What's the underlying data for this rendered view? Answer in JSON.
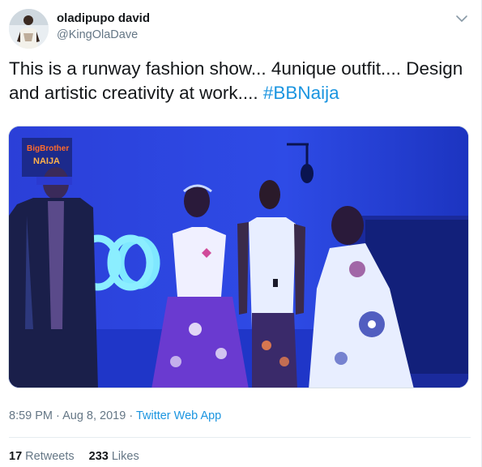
{
  "author": {
    "display_name": "oladipupo david",
    "handle": "@KingOlaDave",
    "avatar_icon": "profile-photo"
  },
  "menu": {
    "icon": "chevron-down-icon"
  },
  "tweet": {
    "text": "This is a runway fashion show... 4unique outfit.... Design and artistic creativity at work....",
    "hashtag": "#BBNaija"
  },
  "media": {
    "overlay_logo_line1": "BigBrother",
    "overlay_logo_line2": "NAIJA",
    "description_icon": "runway-photo"
  },
  "meta": {
    "time": "8:59 PM",
    "separator1": " · ",
    "date": "Aug 8, 2019",
    "separator2": " · ",
    "source": "Twitter Web App"
  },
  "stats": {
    "retweets_count": "17",
    "retweets_label": " Retweets",
    "likes_count": "233",
    "likes_label": " Likes"
  },
  "colors": {
    "link": "#1b95e0",
    "secondary_text": "#657786",
    "primary_text": "#14171a"
  }
}
